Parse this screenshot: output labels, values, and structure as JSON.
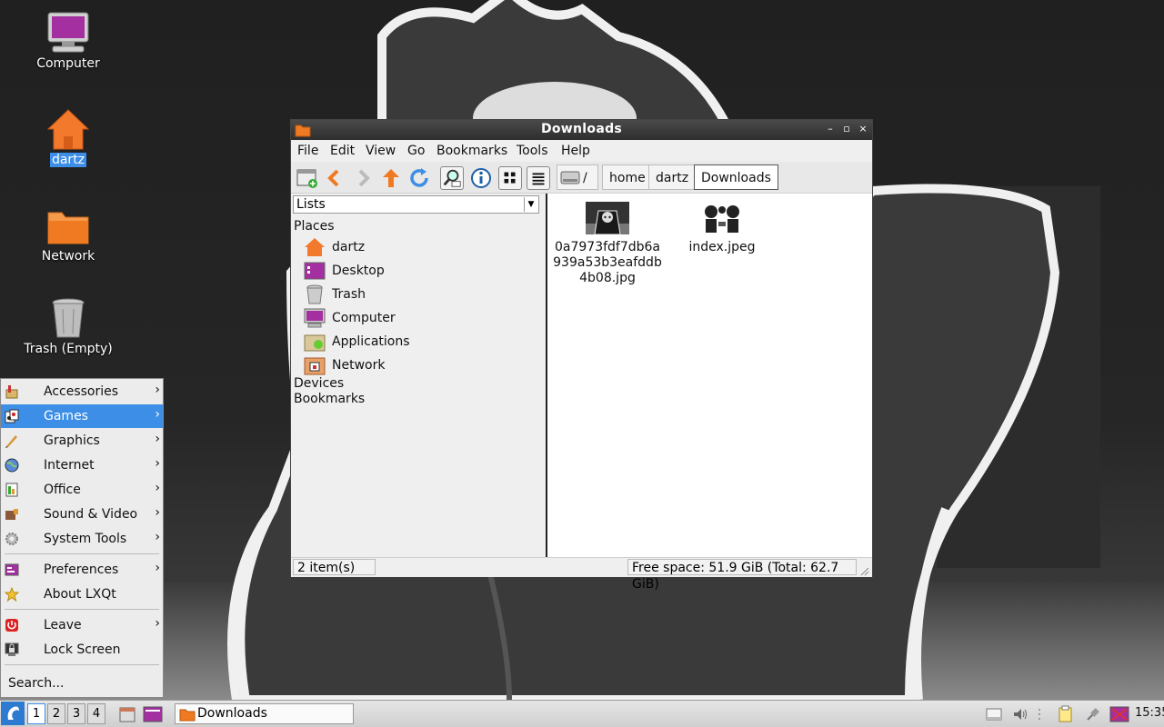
{
  "desktop": {
    "icons": [
      {
        "label": "Computer"
      },
      {
        "label": "dartz"
      },
      {
        "label": "Network"
      },
      {
        "label": "Trash (Empty)"
      }
    ]
  },
  "window": {
    "title": "Downloads",
    "menu": [
      "File",
      "Edit",
      "View",
      "Go",
      "Bookmarks",
      "Tools",
      "Help"
    ],
    "path_root": "/",
    "breadcrumbs": [
      "home",
      "dartz",
      "Downloads"
    ],
    "side": {
      "selector": "Lists",
      "places_header": "Places",
      "places": [
        "dartz",
        "Desktop",
        "Trash",
        "Computer",
        "Applications",
        "Network"
      ],
      "devices_header": "Devices",
      "bookmarks_header": "Bookmarks"
    },
    "files": [
      {
        "name_lines": [
          "0a7973fdf7db6a",
          "939a53b3eafddb",
          "4b08.jpg"
        ]
      },
      {
        "name_lines": [
          "index.jpeg"
        ]
      }
    ],
    "status_count": "2 item(s)",
    "status_space": "Free space: 51.9 GiB (Total: 62.7 GiB)"
  },
  "start_menu": {
    "items": [
      "Accessories",
      "Games",
      "Graphics",
      "Internet",
      "Office",
      "Sound & Video",
      "System Tools",
      "Preferences",
      "About LXQt",
      "Leave",
      "Lock Screen"
    ],
    "highlighted": "Games",
    "search": "Search..."
  },
  "taskbar": {
    "workspaces": [
      "1",
      "2",
      "3",
      "4"
    ],
    "active_task": "Downloads",
    "clock": "15:35"
  },
  "colors": {
    "accent": "#3d8ee6",
    "titlebar": "#333333"
  }
}
